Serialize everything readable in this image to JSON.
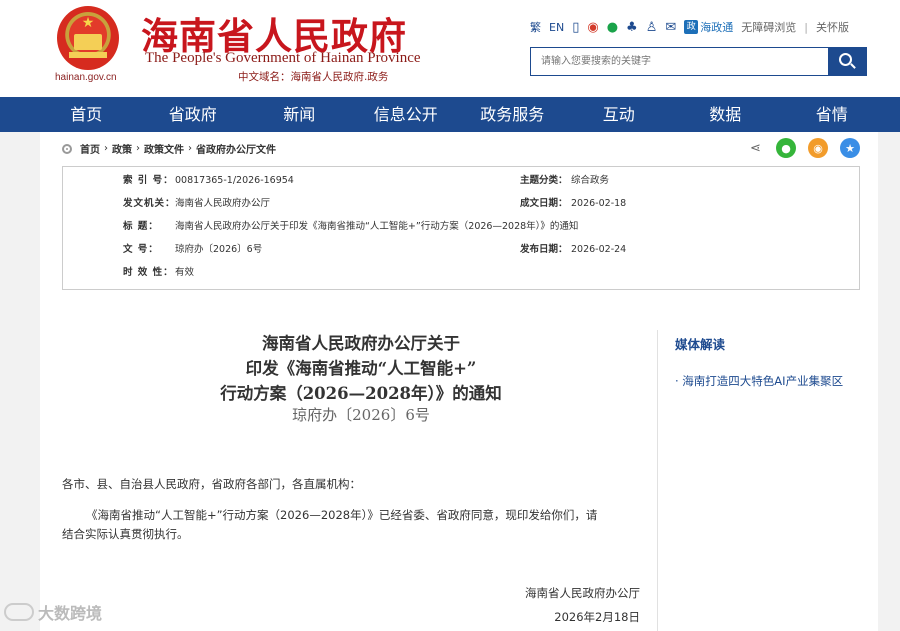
{
  "header": {
    "site_url": "hainan.gov.cn",
    "title_cn": "海南省人民政府",
    "title_en": "The People's Government of Hainan Province",
    "domain_cn": "中文域名：海南省人民政府.政务",
    "links": {
      "traditional": "繁",
      "english": "EN",
      "hainan_app": "海政通",
      "accessible": "无障碍浏览",
      "separator": "|",
      "care": "关怀版"
    },
    "search": {
      "placeholder": "请输入您要搜索的关键字"
    }
  },
  "nav": [
    "首页",
    "省政府",
    "新闻",
    "信息公开",
    "政务服务",
    "互动",
    "数据",
    "省情"
  ],
  "breadcrumb": [
    "首页",
    "政策",
    "政策文件",
    "省政府办公厅文件"
  ],
  "breadcrumb_sep": "›",
  "meta": {
    "index_label": "索 引 号：",
    "index_value": "00817365-1/2026-16954",
    "topic_label": "主题分类：",
    "topic_value": "综合政务",
    "issuer_label": "发文机关：",
    "issuer_value": "海南省人民政府办公厅",
    "date_label": "成文日期：",
    "date_value": "2026-02-18",
    "title_label": "标 题：",
    "title_value": "海南省人民政府办公厅关于印发《海南省推动“人工智能+”行动方案（2026—2028年）》的通知",
    "docno_label": "文 号：",
    "docno_value": "琼府办〔2026〕6号",
    "pub_label": "发布日期：",
    "pub_value": "2026-02-24",
    "valid_label": "时 效 性：",
    "valid_value": "有效"
  },
  "article": {
    "title_lines": [
      "海南省人民政府办公厅关于",
      "印发《海南省推动“人工智能+”",
      "行动方案（2026—2028年）》的通知"
    ],
    "doc_no": "琼府办〔2026〕6号",
    "salutation": "各市、县、自治县人民政府，省政府各部门，各直属机构：",
    "body_line1": "《海南省推动“人工智能+”行动方案（2026—2028年）》已经省委、省政府同意，现印发给你们，请",
    "body_line2": "结合实际认真贯彻执行。",
    "signer": "海南省人民政府办公厅",
    "sign_date": "2026年2月18日"
  },
  "sidebar": {
    "title": "媒体解读",
    "items": [
      "· 海南打造四大特色AI产业集聚区"
    ]
  },
  "watermark": "大数跨境"
}
